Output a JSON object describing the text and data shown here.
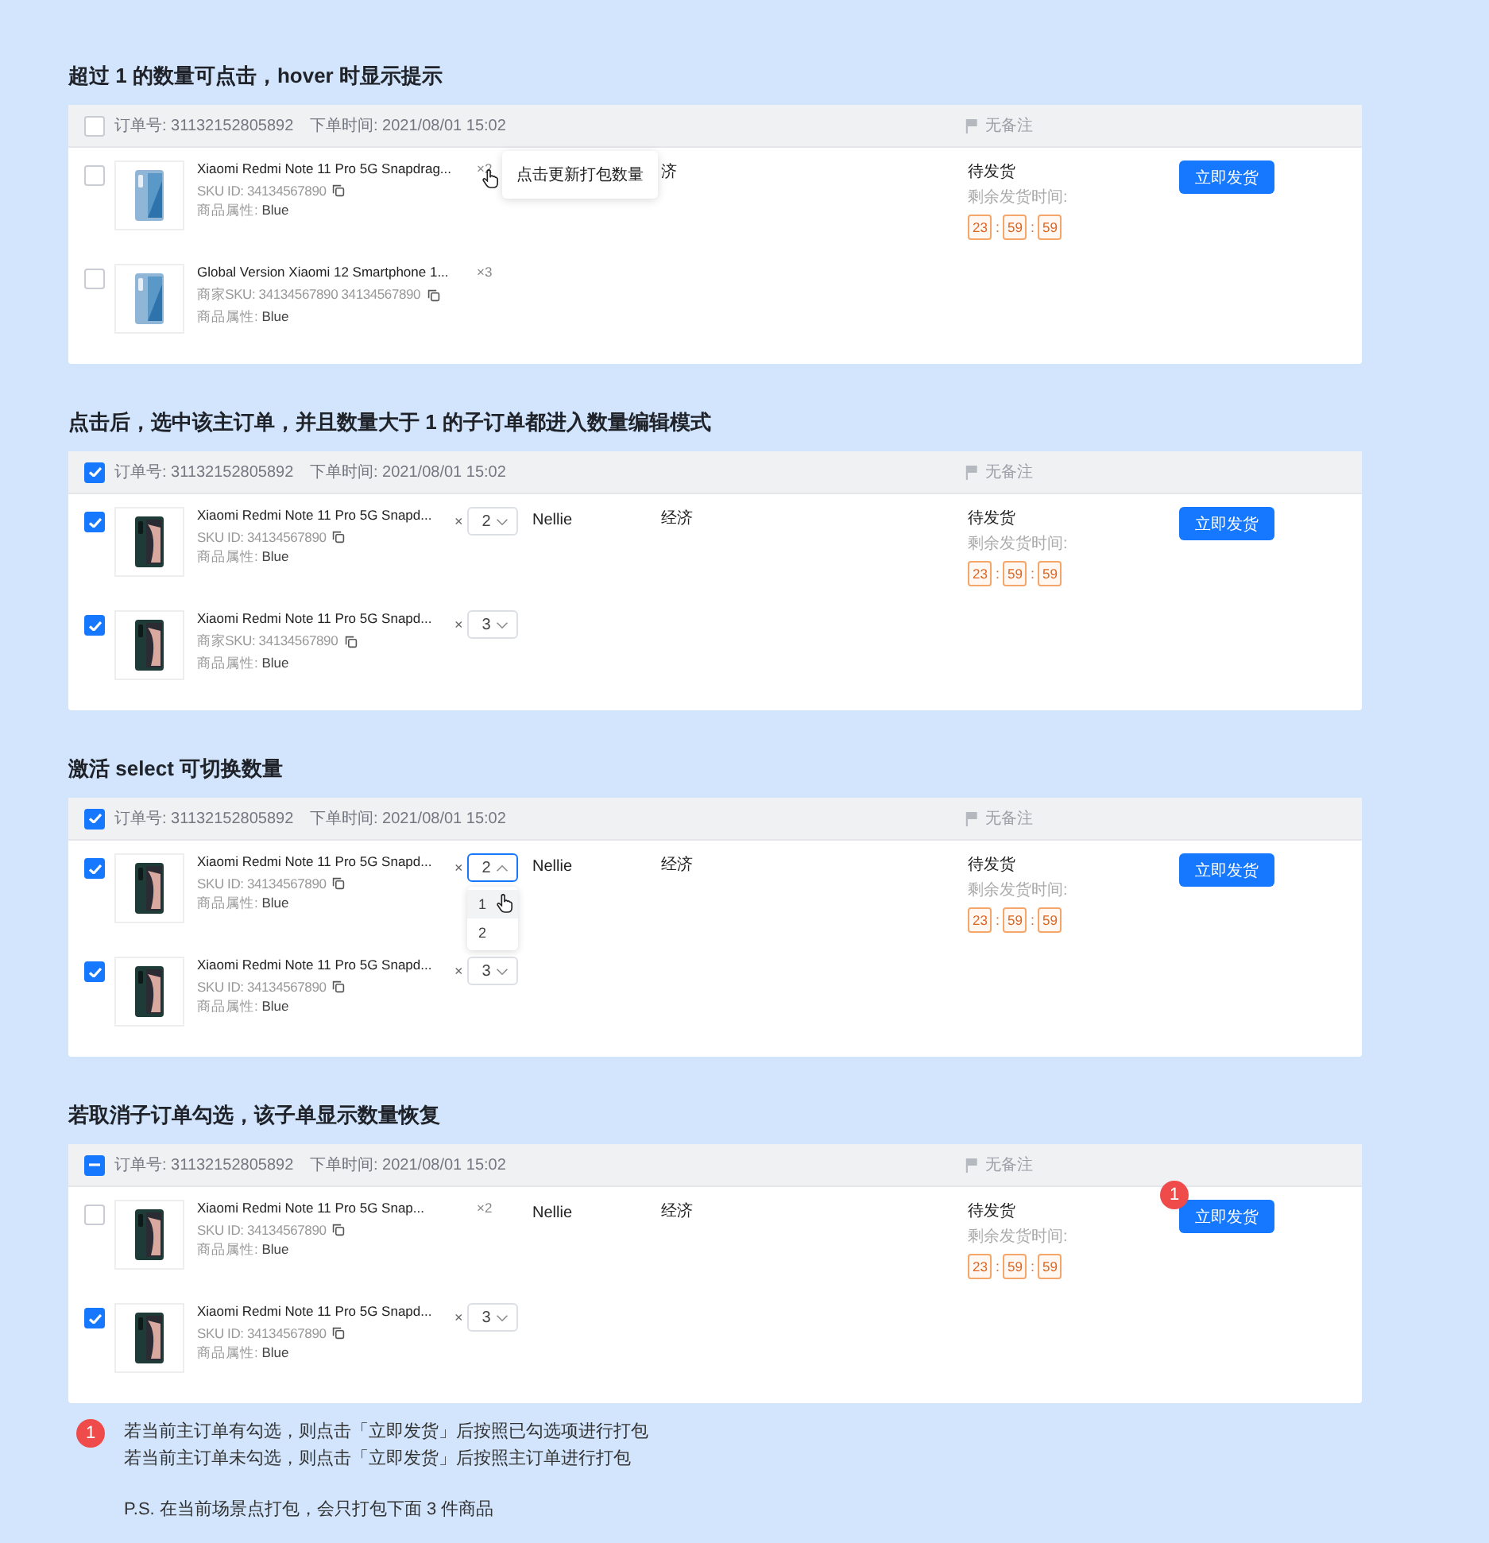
{
  "sections": [
    {
      "heading": "超过 1 的数量可点击，hover 时显示提示",
      "order": {
        "checked": false,
        "partial": false,
        "order_no": "订单号: 31132152805892",
        "order_time": "下单时间: 2021/08/01 15:02",
        "remark": "无备注",
        "status": "待发货",
        "countdown_label": "剩余发货时间:",
        "countdown": [
          "23",
          "59",
          "59"
        ],
        "countdown_separator": ":",
        "button": "立即发货",
        "items": [
          {
            "checked": false,
            "title": "Xiaomi Redmi Note 11 Pro 5G Snapdrag...",
            "sku": "SKU ID: 34134567890",
            "attr_label": "商品属性:",
            "attr_value": "Blue",
            "qty": {
              "kind": "text",
              "value": "×2",
              "hovered": true,
              "tooltip": "点击更新打包数量"
            },
            "shipping": "济"
          },
          {
            "checked": false,
            "title": "Global Version Xiaomi 12 Smartphone 1...",
            "sku": "商家SKU: 34134567890 34134567890",
            "attr_label": "商品属性:",
            "attr_value": "Blue",
            "qty": {
              "kind": "text",
              "value": "×3"
            }
          }
        ]
      }
    },
    {
      "heading": "点击后，选中该主订单，并且数量大于 1 的子订单都进入数量编辑模式",
      "order": {
        "checked": true,
        "partial": false,
        "order_no": "订单号: 31132152805892",
        "order_time": "下单时间: 2021/08/01 15:02",
        "remark": "无备注",
        "status": "待发货",
        "countdown_label": "剩余发货时间:",
        "countdown": [
          "23",
          "59",
          "59"
        ],
        "countdown_separator": ":",
        "button": "立即发货",
        "items": [
          {
            "checked": true,
            "title": "Xiaomi Redmi Note 11 Pro 5G Snapd...",
            "sku": "SKU ID: 34134567890",
            "attr_label": "商品属性:",
            "attr_value": "Blue",
            "qty": {
              "kind": "select",
              "times": "×",
              "value": "2",
              "open": false
            },
            "buyer": "Nellie",
            "shipping": "经济"
          },
          {
            "checked": true,
            "title": "Xiaomi Redmi Note 11 Pro 5G Snapd...",
            "sku": "商家SKU: 34134567890",
            "attr_label": "商品属性:",
            "attr_value": "Blue",
            "qty": {
              "kind": "select",
              "times": "×",
              "value": "3",
              "open": false
            }
          }
        ]
      }
    },
    {
      "heading": "激活 select 可切换数量",
      "order": {
        "checked": true,
        "partial": false,
        "order_no": "订单号: 31132152805892",
        "order_time": "下单时间: 2021/08/01 15:02",
        "remark": "无备注",
        "status": "待发货",
        "countdown_label": "剩余发货时间:",
        "countdown": [
          "23",
          "59",
          "59"
        ],
        "countdown_separator": ":",
        "button": "立即发货",
        "items": [
          {
            "checked": true,
            "title": "Xiaomi Redmi Note 11 Pro 5G Snapd...",
            "sku": "SKU ID: 34134567890",
            "attr_label": "商品属性:",
            "attr_value": "Blue",
            "qty": {
              "kind": "select",
              "times": "×",
              "value": "2",
              "open": true,
              "options": [
                {
                  "label": "1",
                  "hovered": true
                },
                {
                  "label": "2",
                  "hovered": false
                }
              ]
            },
            "buyer": "Nellie",
            "shipping": "经济"
          },
          {
            "checked": true,
            "title": "Xiaomi Redmi Note 11 Pro 5G Snapd...",
            "sku": "SKU ID: 34134567890",
            "attr_label": "商品属性:",
            "attr_value": "Blue",
            "qty": {
              "kind": "select",
              "times": "×",
              "value": "3",
              "open": false
            }
          }
        ]
      }
    },
    {
      "heading": "若取消子订单勾选，该子单显示数量恢复",
      "order": {
        "checked": true,
        "partial": true,
        "order_no": "订单号: 31132152805892",
        "order_time": "下单时间: 2021/08/01 15:02",
        "remark": "无备注",
        "status": "待发货",
        "countdown_label": "剩余发货时间:",
        "countdown": [
          "23",
          "59",
          "59"
        ],
        "countdown_separator": ":",
        "button": "立即发货",
        "badge": "1",
        "items": [
          {
            "checked": false,
            "title": "Xiaomi Redmi Note 11 Pro 5G Snap...",
            "sku": "SKU ID: 34134567890",
            "attr_label": "商品属性:",
            "attr_value": "Blue",
            "qty": {
              "kind": "text",
              "value": "×2"
            },
            "buyer": "Nellie",
            "shipping": "经济"
          },
          {
            "checked": true,
            "title": "Xiaomi Redmi Note 11 Pro 5G Snapd...",
            "sku": "SKU ID: 34134567890",
            "attr_label": "商品属性:",
            "attr_value": "Blue",
            "qty": {
              "kind": "select",
              "times": "×",
              "value": "3",
              "open": false
            }
          }
        ]
      }
    }
  ],
  "note": {
    "badge": "1",
    "lines": [
      "若当前主订单有勾选，则点击「立即发货」后按照已勾选项进行打包",
      "若当前主订单未勾选，则点击「立即发货」后按照主订单进行打包"
    ],
    "ps": "P.S. 在当前场景点打包，会只打包下面 3 件商品"
  }
}
